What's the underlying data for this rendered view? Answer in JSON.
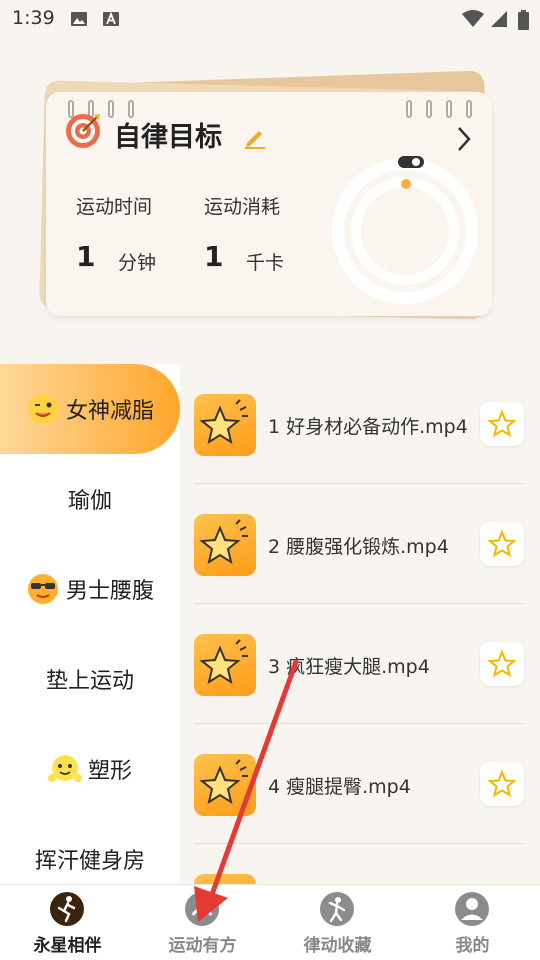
{
  "status_bar": {
    "time": "1:39"
  },
  "goal_card": {
    "title": "自律目标",
    "stats": [
      {
        "label": "运动时间",
        "value": "1",
        "unit": "分钟"
      },
      {
        "label": "运动消耗",
        "value": "1",
        "unit": "千卡"
      }
    ]
  },
  "sidebar": {
    "items": [
      {
        "label": "女神减脂",
        "active": true,
        "icon": "wink-face-icon"
      },
      {
        "label": "瑜伽"
      },
      {
        "label": "男士腰腹",
        "icon": "sunglasses-face-icon"
      },
      {
        "label": "垫上运动"
      },
      {
        "label": "塑形",
        "icon": "flex-face-icon"
      },
      {
        "label": "挥汗健身房"
      }
    ]
  },
  "videos": [
    {
      "title": "1 好身材必备动作.mp4"
    },
    {
      "title": "2 腰腹强化锻炼.mp4"
    },
    {
      "title": "3 疯狂瘦大腿.mp4"
    },
    {
      "title": "4 瘦腿提臀.mp4"
    }
  ],
  "bottom_nav": [
    {
      "label": "永星相伴",
      "active": true,
      "icon": "runner-icon"
    },
    {
      "label": "运动有方",
      "icon": "gauge-icon"
    },
    {
      "label": "律动收藏",
      "icon": "dancer-icon"
    },
    {
      "label": "我的",
      "icon": "person-icon"
    }
  ],
  "colors": {
    "accent": "#ffa62b",
    "accent_light": "#ffd89a",
    "arrow": "#e53935"
  }
}
